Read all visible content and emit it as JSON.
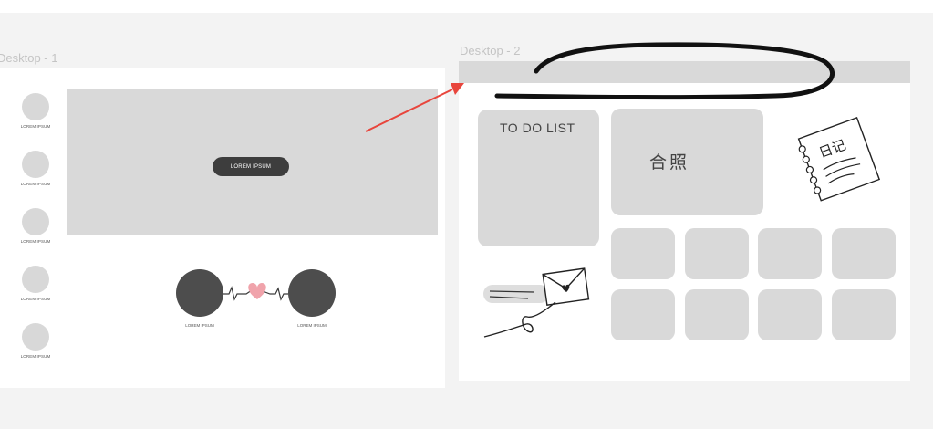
{
  "canvas": {
    "background": "#f3f3f3"
  },
  "desktop1": {
    "title": "Desktop - 1",
    "sidebar_items": [
      {
        "label": "LOREM IPSUM"
      },
      {
        "label": "LOREM IPSUM"
      },
      {
        "label": "LOREM IPSUM"
      },
      {
        "label": "LOREM IPSUM"
      },
      {
        "label": "LOREM IPSUM"
      }
    ],
    "hero_button": "LOREM IPSUM",
    "couple": {
      "left_label": "LOREM IPSUM",
      "right_label": "LOREM IPSUM"
    }
  },
  "desktop2": {
    "title": "Desktop - 2",
    "todo_label": "TO DO LIST",
    "photo_label": "合照",
    "diary_label": "日记"
  },
  "colors": {
    "placeholder": "#d9d9d9",
    "dark": "#3d3d3d",
    "heart": "#f0a3ab",
    "arrow": "#e8453c",
    "sketch": "#111111"
  },
  "icons": [
    "heart-icon",
    "diary-notebook-icon",
    "envelope-icon",
    "red-arrow",
    "black-scribble"
  ]
}
